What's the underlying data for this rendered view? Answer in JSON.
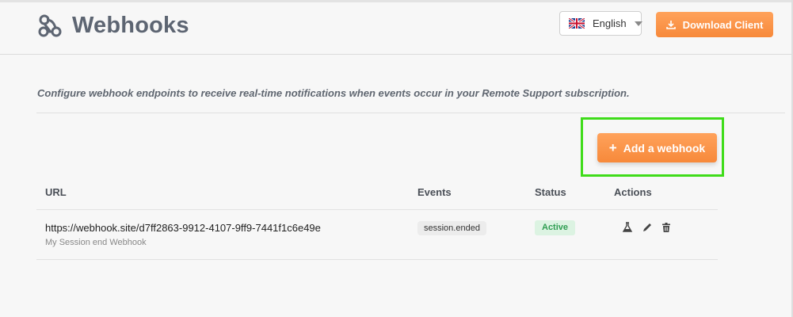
{
  "header": {
    "title": "Webhooks",
    "logo_icon": "webhook-icon",
    "language": {
      "selected": "English",
      "icon": "uk-flag-icon"
    },
    "download_label": "Download Client",
    "download_icon": "download-icon"
  },
  "description": "Configure webhook endpoints to receive real-time notifications when events occur in your Remote Support subscription.",
  "add_button": {
    "label": "Add a webhook",
    "icon": "plus-icon",
    "highlight_color": "#3fdc1a"
  },
  "table": {
    "headers": {
      "url": "URL",
      "events": "Events",
      "status": "Status",
      "actions": "Actions"
    },
    "rows": [
      {
        "url": "https://webhook.site/d7ff2863-9912-4107-9ff9-7441f1c6e49e",
        "name": "My Session end Webhook",
        "events": [
          "session.ended"
        ],
        "status": "Active",
        "actions": [
          "flask-icon",
          "pencil-icon",
          "trash-icon"
        ]
      }
    ]
  },
  "colors": {
    "accent": "#f7893a",
    "status_active_bg": "#dcf3e2",
    "status_active_text": "#2e9d51"
  }
}
